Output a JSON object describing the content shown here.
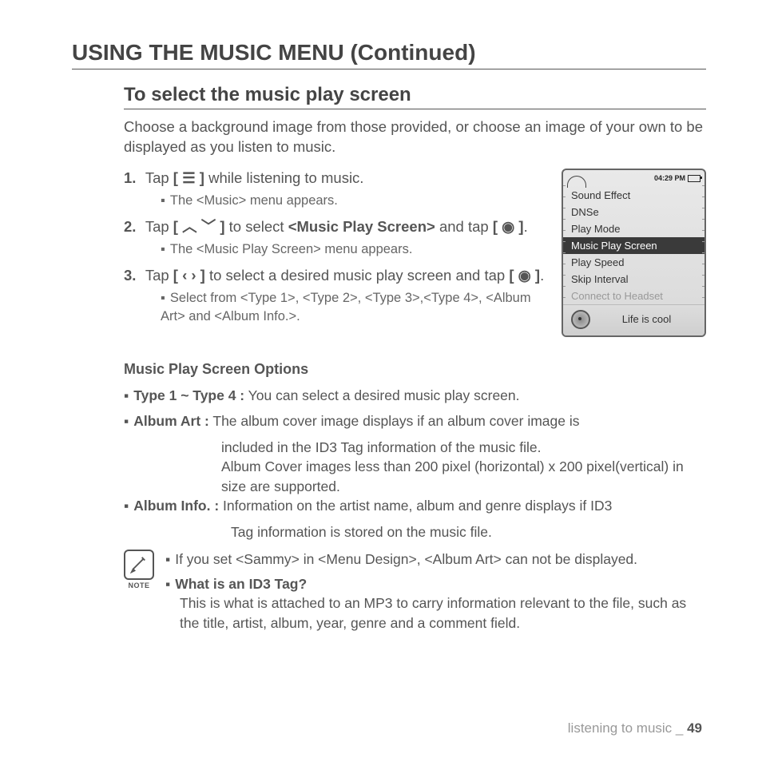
{
  "heading": "USING THE MUSIC MENU (Continued)",
  "section": {
    "title": "To select the music play screen",
    "intro": "Choose a background image from those provided, or choose an image of your own to be displayed as you listen to music."
  },
  "steps": [
    {
      "num": "1.",
      "pre": "Tap ",
      "icon": "[ ☰ ]",
      "post": " while listening to music.",
      "sub": "The <Music> menu appears."
    },
    {
      "num": "2.",
      "pre": "Tap ",
      "icon": "[ ︿ ﹀ ]",
      "mid": " to select ",
      "bold": "<Music Play Screen>",
      "post2": " and tap ",
      "icon2": "[ ◉ ]",
      "tail": ".",
      "sub": "The <Music Play Screen> menu appears."
    },
    {
      "num": "3.",
      "pre": "Tap ",
      "icon": "[ ‹  › ]",
      "post": " to select a desired music play screen and tap ",
      "icon2": "[ ◉ ]",
      "tail": ".",
      "sub": "Select from <Type 1>, <Type 2>, <Type 3>,<Type 4>, <Album Art> and <Album Info.>."
    }
  ],
  "device": {
    "time": "04:29 PM",
    "scroll_top": "5",
    "scroll_bottom": "7",
    "left_marks": [
      "C",
      "0"
    ],
    "items": [
      {
        "label": "Sound Effect",
        "sel": false,
        "dim": false
      },
      {
        "label": "DNSe",
        "sel": false,
        "dim": false
      },
      {
        "label": "Play Mode",
        "sel": false,
        "dim": false
      },
      {
        "label": "Music Play Screen",
        "sel": true,
        "dim": false
      },
      {
        "label": "Play Speed",
        "sel": false,
        "dim": false
      },
      {
        "label": "Skip Interval",
        "sel": false,
        "dim": false
      },
      {
        "label": "Connect to Headset",
        "sel": false,
        "dim": true
      }
    ],
    "track": "Life is cool"
  },
  "options_heading": "Music Play Screen Options",
  "options": [
    {
      "label": "Type 1 ~ Type 4 :",
      "text": " You can select a desired music play screen."
    },
    {
      "label": "Album Art :",
      "text": " The album cover image displays if an album cover image is",
      "cont": [
        "included in the ID3 Tag information of the music file.",
        "Album Cover images less than 200 pixel (horizontal) x 200 pixel(vertical) in size are supported."
      ]
    },
    {
      "label": "Album Info. :",
      "text": " Information on the artist name, album and genre displays if ID3",
      "cont2": [
        "Tag information is stored on the music file."
      ]
    }
  ],
  "note": {
    "label": "NOTE",
    "line1": "If you set <Sammy> in <Menu Design>, <Album Art> can not be displayed.",
    "q": "What is an ID3 Tag?",
    "ans": "This is what is attached to an MP3 to carry information relevant to the file, such as the title, artist, album, year, genre and a comment field."
  },
  "footer": {
    "section": "listening to music",
    "sep": " _ ",
    "page": "49"
  }
}
